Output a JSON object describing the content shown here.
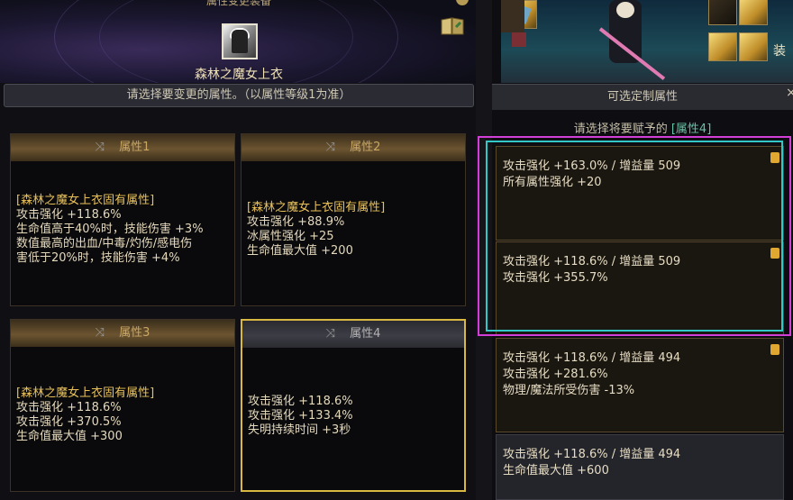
{
  "top_partial_title": "属性变更装备",
  "item_name": "森林之魔女上衣",
  "instruction": "请选择要变更的属性。（以属性等级1为准）",
  "properties": [
    {
      "title": "属性1",
      "tag": "[森林之魔女上衣固有属性]",
      "lines": [
        "攻击强化 +118.6%",
        "生命值高于40%时，技能伤害 +3%",
        "数值最高的出血/中毒/灼伤/感电伤",
        "害低于20%时，技能伤害 +4%"
      ]
    },
    {
      "title": "属性2",
      "tag": "[森林之魔女上衣固有属性]",
      "lines": [
        "攻击强化 +88.9%",
        "冰属性强化 +25",
        "生命值最大值 +200"
      ]
    },
    {
      "title": "属性3",
      "tag": "[森林之魔女上衣固有属性]",
      "lines": [
        "攻击强化 +118.6%",
        "攻击强化 +370.5%",
        "生命值最大值 +300"
      ]
    },
    {
      "title": "属性4",
      "tag": "",
      "lines": [
        "攻击强化 +118.6%",
        "攻击强化 +133.4%",
        "失明持续时间 +3秒"
      ]
    }
  ],
  "right_panel": {
    "title": "可选定制属性",
    "close": "×",
    "prompt_prefix": "请选择将要赋予的",
    "prompt_hl": "[属性4]",
    "options": [
      {
        "lines": [
          "攻击强化 +163.0% / 增益量 509",
          "所有属性强化 +20"
        ]
      },
      {
        "lines": [
          "攻击强化 +118.6% / 增益量 509",
          "攻击强化 +355.7%"
        ]
      },
      {
        "lines": [
          "攻击强化 +118.6% / 增益量 494",
          "攻击强化 +281.6%",
          "物理/魔法所受伤害 -13%"
        ]
      },
      {
        "lines": [
          "攻击强化 +118.6% / 增益量 494",
          "生命值最大值 +600"
        ]
      }
    ]
  },
  "scene_partial_text": "装"
}
